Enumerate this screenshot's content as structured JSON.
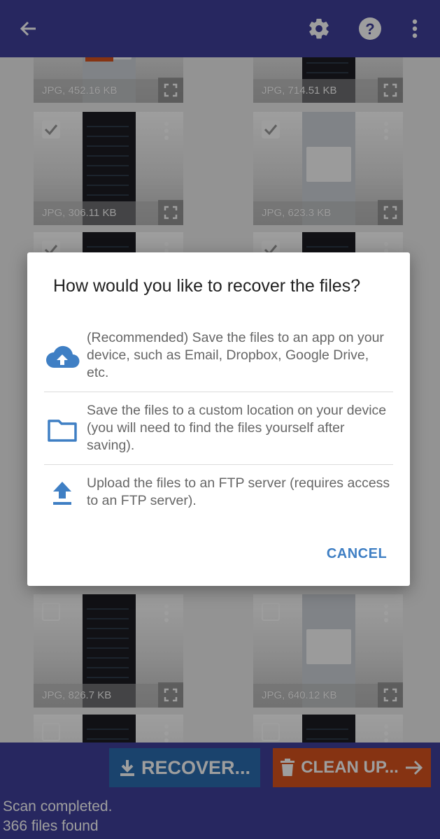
{
  "appbar": {
    "back_icon": "arrow-left-icon",
    "settings_icon": "gear-icon",
    "help_icon": "help-circle-icon",
    "menu_icon": "more-vertical-icon",
    "color": "#3f3f9c"
  },
  "tiles": [
    {
      "caption": "JPG, 452.16 KB",
      "checked": null
    },
    {
      "caption": "JPG, 714.51 KB",
      "checked": null
    },
    {
      "caption": "JPG, 306.11 KB",
      "checked": true
    },
    {
      "caption": "JPG, 623.3 KB",
      "checked": true
    },
    {
      "caption": "",
      "checked": true
    },
    {
      "caption": "",
      "checked": true
    },
    {
      "caption": "JPG, 826.7 KB",
      "checked": false
    },
    {
      "caption": "JPG, 640.12 KB",
      "checked": false
    },
    {
      "caption": "",
      "checked": false
    },
    {
      "caption": "",
      "checked": false
    }
  ],
  "dialog": {
    "title": "How would you like to recover the files?",
    "options": [
      {
        "icon": "cloud-upload-icon",
        "text": "(Recommended) Save the files to an app on your device, such as Email, Dropbox, Google Drive, etc."
      },
      {
        "icon": "folder-icon",
        "text": "Save the files to a custom location on your device (you will need to find the files yourself after saving)."
      },
      {
        "icon": "upload-icon",
        "text": "Upload the files to an FTP server (requires access to an FTP server)."
      }
    ],
    "cancel_label": "CANCEL",
    "accent_color": "#3f7fc4"
  },
  "bottombar": {
    "recover_label": "RECOVER...",
    "cleanup_label": "CLEAN UP...",
    "status_line1": "Scan completed.",
    "status_line2": "366 files found",
    "recover_color": "#2b6db0",
    "cleanup_color": "#d9531e"
  }
}
